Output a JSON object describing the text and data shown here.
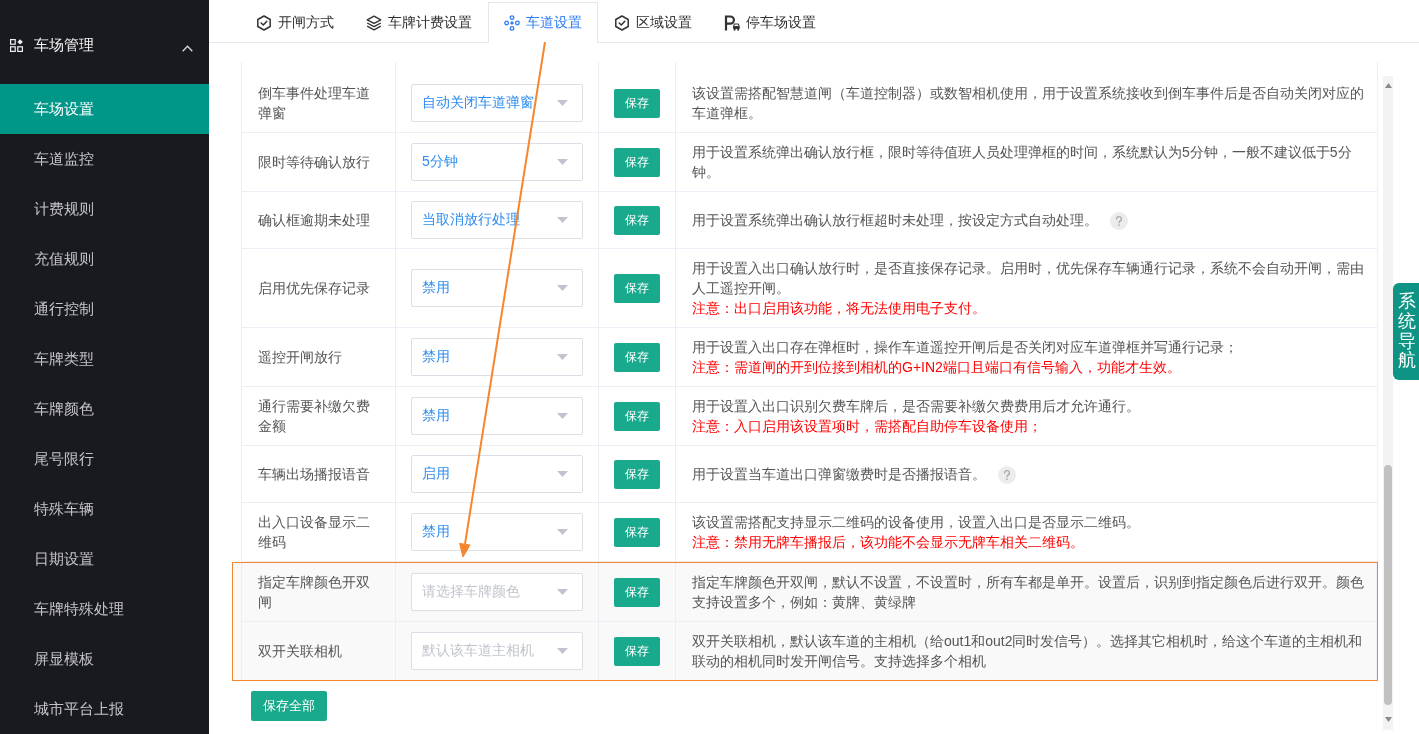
{
  "sidebar": {
    "group": {
      "title": "车场管理",
      "expanded": true
    },
    "items": [
      {
        "label": "车场设置",
        "selected": true
      },
      {
        "label": "车道监控",
        "selected": false
      },
      {
        "label": "计费规则",
        "selected": false
      },
      {
        "label": "充值规则",
        "selected": false
      },
      {
        "label": "通行控制",
        "selected": false
      },
      {
        "label": "车牌类型",
        "selected": false
      },
      {
        "label": "车牌颜色",
        "selected": false
      },
      {
        "label": "尾号限行",
        "selected": false
      },
      {
        "label": "特殊车辆",
        "selected": false
      },
      {
        "label": "日期设置",
        "selected": false
      },
      {
        "label": "车牌特殊处理",
        "selected": false
      },
      {
        "label": "屏显模板",
        "selected": false
      },
      {
        "label": "城市平台上报",
        "selected": false
      }
    ]
  },
  "tabs": [
    {
      "label": "开闸方式",
      "selected": false
    },
    {
      "label": "车牌计费设置",
      "selected": false
    },
    {
      "label": "车道设置",
      "selected": true
    },
    {
      "label": "区域设置",
      "selected": false
    },
    {
      "label": "停车场设置",
      "selected": false
    }
  ],
  "rows": [
    {
      "label": "倒车事件处理车道弹窗",
      "select": {
        "value": "自动关闭车道弹窗"
      },
      "button": "保存",
      "description": "该设置需搭配智慧道闸（车道控制器）或数智相机使用，用于设置系统接收到倒车事件后是否自动关闭对应的车道弹框。",
      "help": false,
      "highlighted": false
    },
    {
      "label": "限时等待确认放行",
      "select": {
        "value": "5分钟"
      },
      "button": "保存",
      "description": "用于设置系统弹出确认放行框，限时等待值班人员处理弹框的时间，系统默认为5分钟，一般不建议低于5分钟。",
      "help": false,
      "highlighted": false
    },
    {
      "label": "确认框逾期未处理",
      "select": {
        "value": "当取消放行处理"
      },
      "button": "保存",
      "description": "用于设置系统弹出确认放行框超时未处理，按设定方式自动处理。",
      "help": true,
      "highlighted": false
    },
    {
      "label": "启用优先保存记录",
      "select": {
        "value": "禁用"
      },
      "button": "保存",
      "description": "用于设置入出口确认放行时，是否直接保存记录。启用时，优先保存车辆通行记录，系统不会自动开闸，需由人工遥控开闸。",
      "note": "注意：出口启用该功能，将无法使用电子支付。",
      "help": false,
      "highlighted": false
    },
    {
      "label": "遥控开闸放行",
      "select": {
        "value": "禁用"
      },
      "button": "保存",
      "description": "用于设置入出口存在弹框时，操作车道遥控开闸后是否关闭对应车道弹框并写通行记录；",
      "note": "注意：需道闸的开到位接到相机的G+IN2端口且端口有信号输入，功能才生效。",
      "help": false,
      "highlighted": false
    },
    {
      "label": "通行需要补缴欠费金额",
      "select": {
        "value": "禁用"
      },
      "button": "保存",
      "description": "用于设置入出口识别欠费车牌后，是否需要补缴欠费费用后才允许通行。",
      "note": "注意：入口启用该设置项时，需搭配自助停车设备使用；",
      "help": false,
      "highlighted": false
    },
    {
      "label": "车辆出场播报语音",
      "select": {
        "value": "启用"
      },
      "button": "保存",
      "description": "用于设置当车道出口弹窗缴费时是否播报语音。",
      "help": true,
      "highlighted": false
    },
    {
      "label": "出入口设备显示二维码",
      "select": {
        "value": "禁用"
      },
      "button": "保存",
      "description": "该设置需搭配支持显示二维码的设备使用，设置入出口是否显示二维码。",
      "note": "注意：禁用无牌车播报后，该功能不会显示无牌车相关二维码。",
      "help": false,
      "highlighted": false
    },
    {
      "label": "指定车牌颜色开双闸",
      "select": {
        "placeholder": "请选择车牌颜色"
      },
      "button": "保存",
      "description": "指定车牌颜色开双闸，默认不设置，不设置时，所有车都是单开。设置后，识别到指定颜色后进行双开。颜色支持设置多个，例如：黄牌、黄绿牌",
      "help": false,
      "highlighted": true
    },
    {
      "label": "双开关联相机",
      "select": {
        "placeholder": "默认该车道主相机"
      },
      "button": "保存",
      "description": "双开关联相机，默认该车道的主相机（给out1和out2同时发信号）。选择其它相机时，给这个车道的主相机和联动的相机同时发开闸信号。支持选择多个相机",
      "help": false,
      "highlighted": true
    }
  ],
  "save_all_button": "保存全部",
  "side_nav_tab": "系统导航"
}
